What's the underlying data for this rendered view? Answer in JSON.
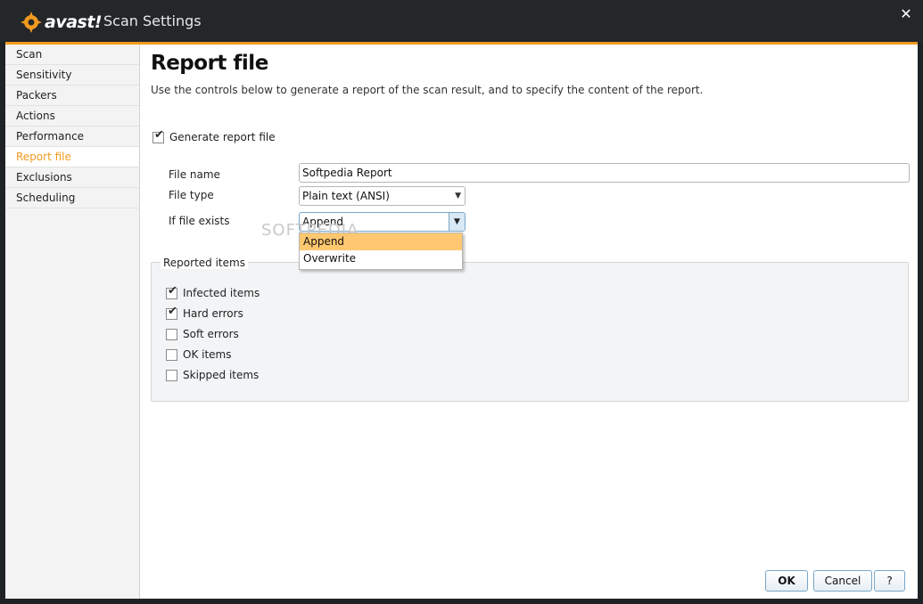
{
  "window": {
    "brand": "avast!",
    "title": "Scan Settings",
    "close_glyph": "✕"
  },
  "sidebar": {
    "items": [
      {
        "label": "Scan"
      },
      {
        "label": "Sensitivity"
      },
      {
        "label": "Packers"
      },
      {
        "label": "Actions"
      },
      {
        "label": "Performance"
      },
      {
        "label": "Report file",
        "active": true
      },
      {
        "label": "Exclusions"
      },
      {
        "label": "Scheduling"
      }
    ]
  },
  "main": {
    "title": "Report file",
    "description": "Use the controls below to generate a report of the scan result, and to specify the content of the report.",
    "generate_report": {
      "label": "Generate report file",
      "checked": true
    },
    "file_name": {
      "label": "File name",
      "value": "Softpedia Report"
    },
    "file_type": {
      "label": "File type",
      "value": "Plain text (ANSI)"
    },
    "if_exists": {
      "label": "If file exists",
      "value": "Append",
      "options": [
        "Append",
        "Overwrite"
      ],
      "highlighted": "Append"
    },
    "watermark": "SOFTPEDIA",
    "reported_items": {
      "legend": "Reported items",
      "items": [
        {
          "label": "Infected items",
          "checked": true
        },
        {
          "label": "Hard errors",
          "checked": true
        },
        {
          "label": "Soft errors",
          "checked": false
        },
        {
          "label": "OK items",
          "checked": false
        },
        {
          "label": "Skipped items",
          "checked": false
        }
      ]
    }
  },
  "buttons": {
    "ok": "OK",
    "cancel": "Cancel",
    "help": "?"
  },
  "colors": {
    "accent": "#f29a1f",
    "titlebar": "#23272a",
    "dropdown_highlight": "#ffc870"
  }
}
